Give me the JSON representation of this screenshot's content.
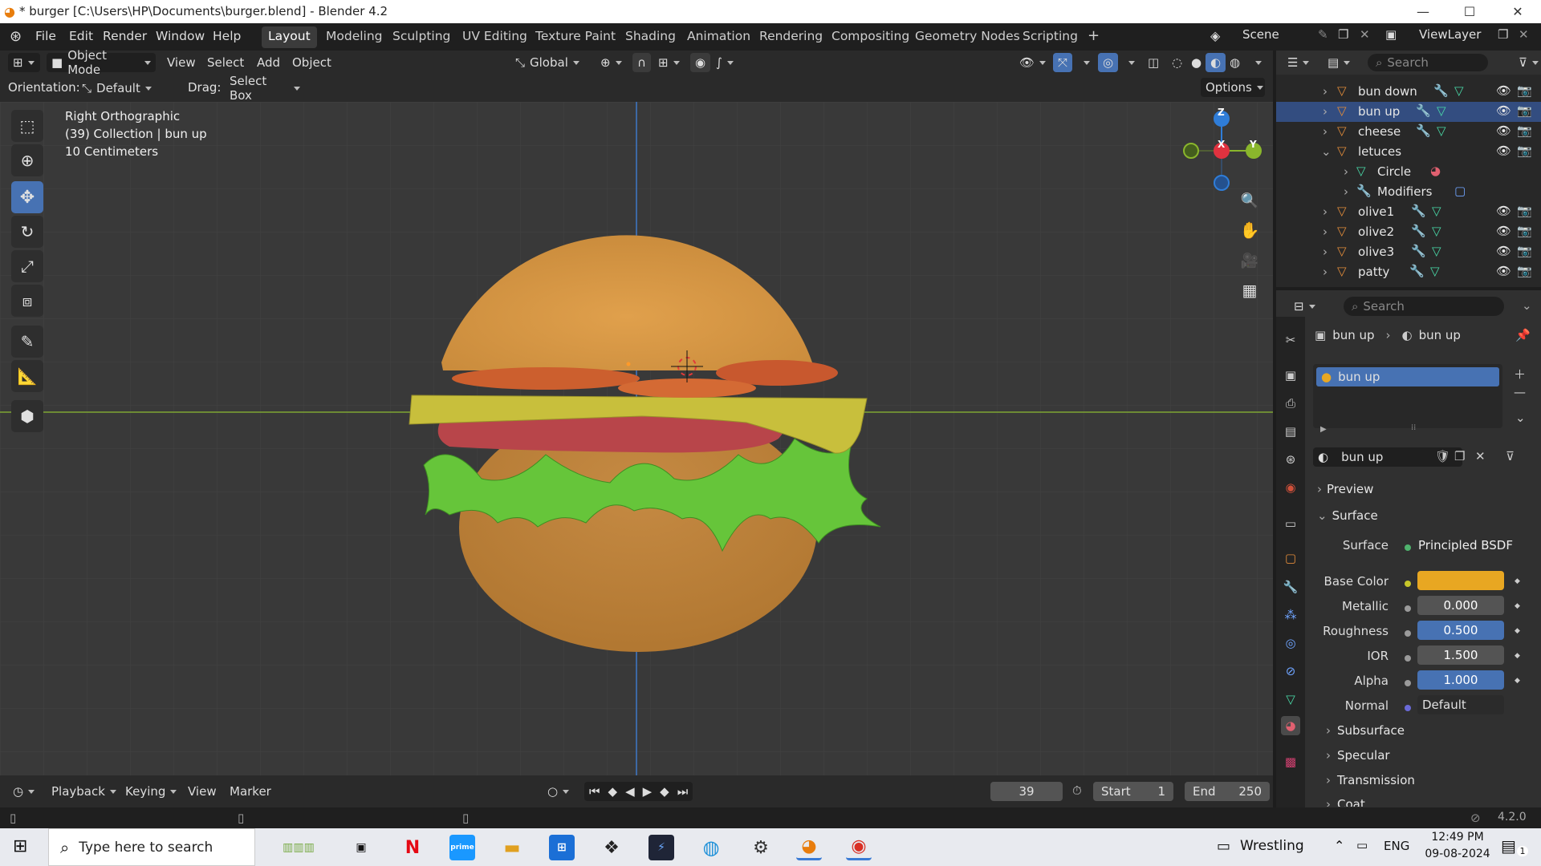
{
  "window": {
    "title": "* burger [C:\\Users\\HP\\Documents\\burger.blend] - Blender 4.2",
    "minimize": "—",
    "maximize": "☐",
    "close": "✕"
  },
  "menu": [
    "File",
    "Edit",
    "Render",
    "Window",
    "Help"
  ],
  "workspaces": [
    "Layout",
    "Modeling",
    "Sculpting",
    "UV Editing",
    "Texture Paint",
    "Shading",
    "Animation",
    "Rendering",
    "Compositing",
    "Geometry Nodes",
    "Scripting"
  ],
  "workspace_add": "+",
  "scene": {
    "name": "Scene",
    "view_layer": "ViewLayer"
  },
  "viewport_header": {
    "mode": "Object Mode",
    "menus": [
      "View",
      "Select",
      "Add",
      "Object"
    ],
    "transform": "Global"
  },
  "toolsettings": {
    "orientation_label": "Orientation:",
    "orientation_value": "Default",
    "drag_label": "Drag:",
    "drag_value": "Select Box",
    "options": "Options"
  },
  "viewport": {
    "line1": "Right Orthographic",
    "line2": "(39) Collection | bun up",
    "line3": "10 Centimeters",
    "gizmo_z": "Z",
    "gizmo_x": "X",
    "gizmo_y": "Y"
  },
  "outliner": {
    "search_placeholder": "Search",
    "rows": [
      {
        "label": "bun down"
      },
      {
        "label": "bun up"
      },
      {
        "label": "cheese"
      },
      {
        "label": "letuces"
      },
      {
        "label": "Circle"
      },
      {
        "label": "Modifiers"
      },
      {
        "label": "olive1"
      },
      {
        "label": "olive2"
      },
      {
        "label": "olive3"
      },
      {
        "label": "patty"
      }
    ]
  },
  "properties": {
    "search_placeholder": "Search",
    "breadcrumb_object": "bun up",
    "breadcrumb_material": "bun up",
    "slot": "bun up",
    "material_name": "bun up",
    "preview": "Preview",
    "surface_section": "Surface",
    "surface_label": "Surface",
    "surface_value": "Principled BSDF",
    "base_color_label": "Base Color",
    "base_color": "#e8a722",
    "metallic_label": "Metallic",
    "metallic": "0.000",
    "roughness_label": "Roughness",
    "roughness": "0.500",
    "ior_label": "IOR",
    "ior": "1.500",
    "alpha_label": "Alpha",
    "alpha": "1.000",
    "normal_label": "Normal",
    "normal": "Default",
    "subsections": [
      "Subsurface",
      "Specular",
      "Transmission",
      "Coat"
    ]
  },
  "timeline": {
    "menus": [
      "Playback",
      "Keying",
      "View",
      "Marker"
    ],
    "frame": "39",
    "start_label": "Start",
    "start": "1",
    "end_label": "End",
    "end": "250"
  },
  "status": {
    "version": "4.2.0"
  },
  "taskbar": {
    "search_placeholder": "Type here to search",
    "weather": "Wrestling",
    "lang": "ENG",
    "time": "12:49 PM",
    "date": "09-08-2024",
    "notif": "1"
  },
  "colors": {
    "accent": "#4772b3",
    "axis_y": "#7fa532",
    "axis_z": "#3f78c8",
    "gizmo_x": "#e0323f",
    "gizmo_y": "#8ab62c",
    "gizmo_z": "#2f7dd8",
    "object_orange": "#e08b3a"
  }
}
